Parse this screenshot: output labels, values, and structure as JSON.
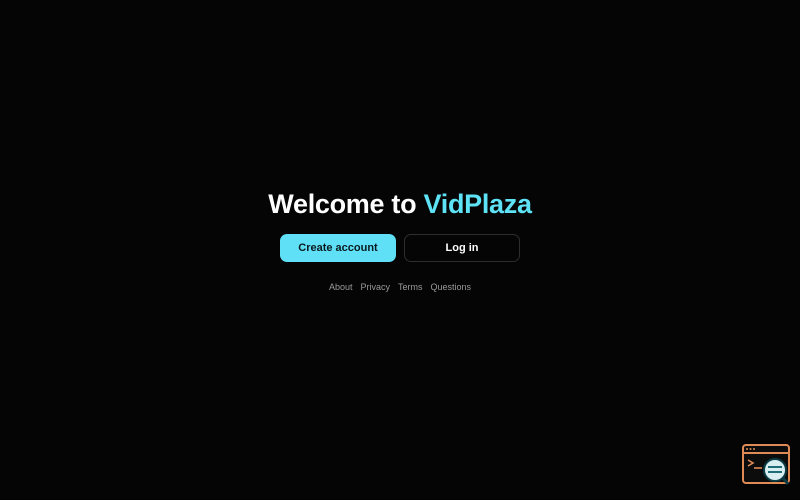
{
  "hero": {
    "title_prefix": "Welcome to",
    "title_brand": "VidPlaza"
  },
  "actions": {
    "create_account_label": "Create account",
    "login_label": "Log in"
  },
  "footer": {
    "links": [
      "About",
      "Privacy",
      "Terms",
      "Questions"
    ]
  },
  "colors": {
    "background": "#050505",
    "accent": "#5fe0f7",
    "devtools_accent": "#e08a55"
  },
  "icons": {
    "corner_tool": "devtools-inspector-icon"
  }
}
